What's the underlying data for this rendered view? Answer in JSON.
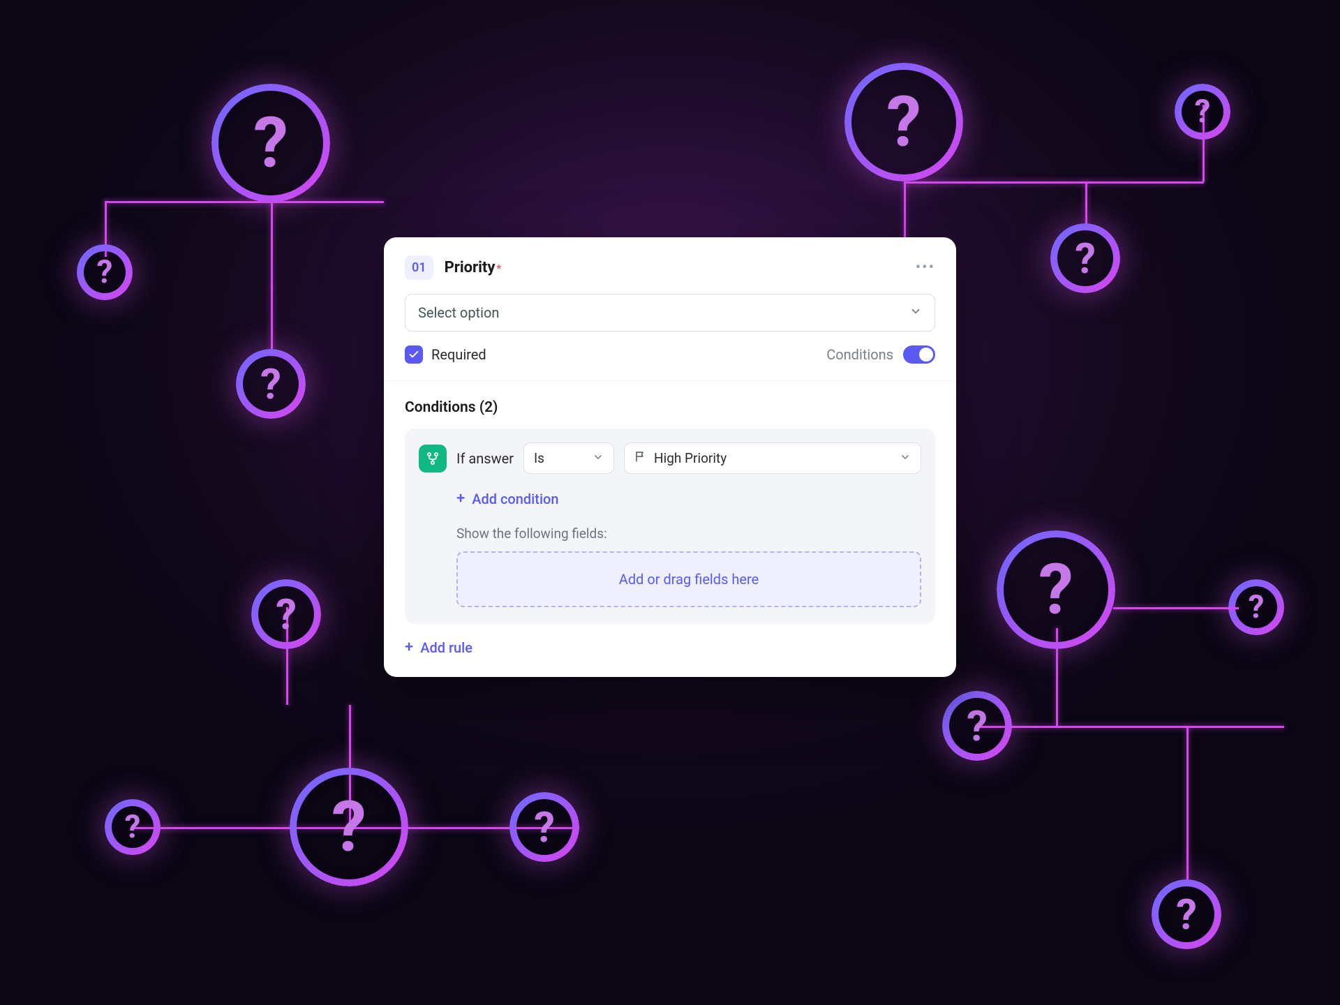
{
  "question": {
    "number": "01",
    "title": "Priority",
    "required_marker": "*",
    "select_placeholder": "Select option",
    "required_label": "Required",
    "required_checked": true,
    "conditions_label": "Conditions",
    "conditions_on": true
  },
  "conditions": {
    "heading": "Conditions (2)",
    "rule": {
      "if_label": "If answer",
      "operator": "Is",
      "value": "High Priority",
      "add_condition_label": "Add condition",
      "show_fields_label": "Show the following fields:",
      "dropzone_text": "Add or drag fields here"
    },
    "add_rule_label": "Add rule"
  },
  "icons": {
    "question_glyph": "?",
    "more": "•••"
  }
}
